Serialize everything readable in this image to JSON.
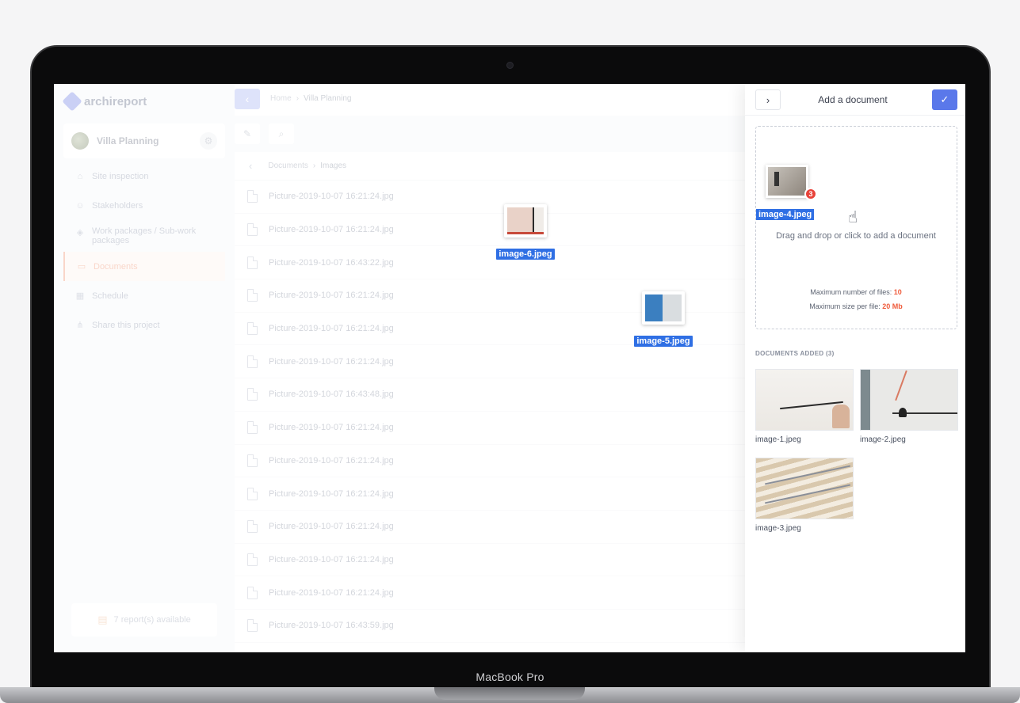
{
  "device": {
    "label": "MacBook Pro"
  },
  "app": {
    "brand": "archireport",
    "topbar": {
      "back_icon": "chevron-left-icon",
      "breadcrumb": [
        "Home",
        "Villa Planning"
      ],
      "separator": "›"
    },
    "project": {
      "name": "Villa Planning"
    },
    "nav": [
      {
        "label": "Site inspection",
        "icon": "home-icon"
      },
      {
        "label": "Stakeholders",
        "icon": "users-icon"
      },
      {
        "label": "Work packages / Sub-work packages",
        "icon": "box-icon"
      },
      {
        "label": "Documents",
        "icon": "folder-icon",
        "active": true
      },
      {
        "label": "Schedule",
        "icon": "calendar-icon"
      },
      {
        "label": "Share this project",
        "icon": "share-icon"
      }
    ],
    "reports": {
      "label": "7 report(s) available"
    },
    "files": {
      "path": [
        "Documents",
        "Images"
      ],
      "rows": [
        "Picture-2019-10-07 16:21:24.jpg",
        "Picture-2019-10-07 16:21:24.jpg",
        "Picture-2019-10-07 16:43:22.jpg",
        "Picture-2019-10-07 16:21:24.jpg",
        "Picture-2019-10-07 16:21:24.jpg",
        "Picture-2019-10-07 16:21:24.jpg",
        "Picture-2019-10-07 16:43:48.jpg",
        "Picture-2019-10-07 16:21:24.jpg",
        "Picture-2019-10-07 16:21:24.jpg",
        "Picture-2019-10-07 16:21:24.jpg",
        "Picture-2019-10-07 16:21:24.jpg",
        "Picture-2019-10-07 16:21:24.jpg",
        "Picture-2019-10-07 16:21:24.jpg",
        "Picture-2019-10-07 16:43:59.jpg"
      ]
    },
    "dragging": [
      {
        "name": "image-6.jpeg"
      },
      {
        "name": "image-5.jpeg"
      }
    ]
  },
  "panel": {
    "title": "Add a document",
    "dropzone": {
      "dragged_file": "image-4.jpeg",
      "count_badge": "3",
      "instruction": "Drag and drop or click to add a document",
      "max_files_label": "Maximum number of files:",
      "max_files_value": "10",
      "max_size_label": "Maximum size per file:",
      "max_size_value": "20 Mb"
    },
    "added_title": "DOCUMENTS ADDED (3)",
    "documents": [
      {
        "name": "image-1.jpeg"
      },
      {
        "name": "image-2.jpeg"
      },
      {
        "name": "image-3.jpeg"
      }
    ]
  },
  "colors": {
    "accent": "#5a78ea",
    "active_nav": "#f2a488",
    "badge": "#e8433a",
    "drag_label": "#2f6fe4",
    "limit_value": "#ef5b3b"
  }
}
